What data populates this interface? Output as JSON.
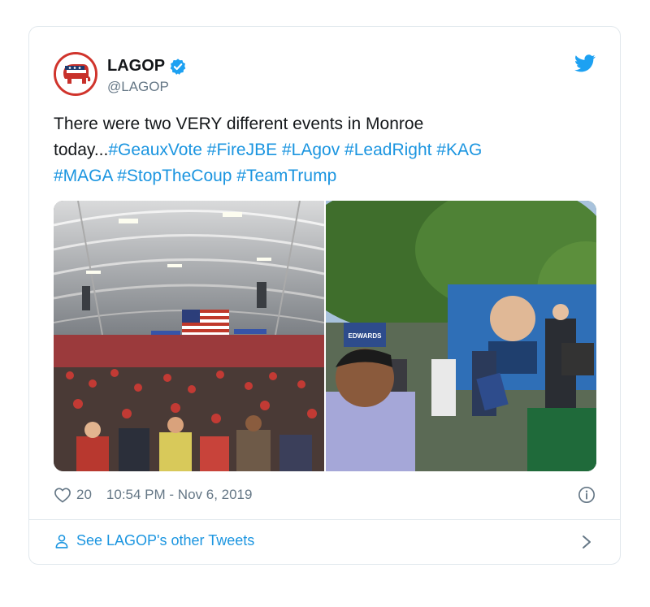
{
  "author": {
    "display_name": "LAGOP",
    "handle": "@LAGOP",
    "verified": true,
    "avatar_icon": "republican-elephant-icon"
  },
  "tweet": {
    "line1_text": "There were two VERY different events in Monroe",
    "line2_lead": "today...",
    "hashtags": [
      "#GeauxVote",
      "#FireJBE",
      "#LAgov",
      "#LeadRight",
      "#KAG",
      "#MAGA",
      "#StopTheCoup",
      "#TeamTrump"
    ]
  },
  "media": {
    "left_photo": "arena-rally-crowd-photo",
    "right_photo": "outdoor-campaign-event-photo",
    "right_photo_sign_text": "EDWARDS"
  },
  "footer": {
    "like_count": "20",
    "timestamp": "10:54 PM - Nov 6, 2019",
    "more_tweets_label": "See LAGOP's other Tweets"
  },
  "colors": {
    "link": "#1b95e0",
    "text": "#14171a",
    "muted": "#657786",
    "border": "#e1e8ed",
    "brand_red": "#d0342c"
  }
}
